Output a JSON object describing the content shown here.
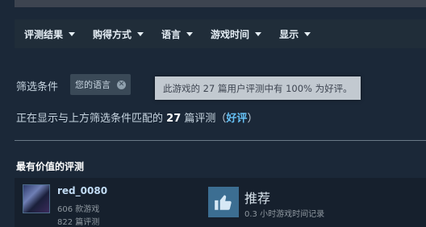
{
  "filter_bar": {
    "items": [
      {
        "label": "评测结果"
      },
      {
        "label": "购得方式"
      },
      {
        "label": "语言"
      },
      {
        "label": "游戏时间"
      },
      {
        "label": "显示"
      }
    ]
  },
  "filters": {
    "label": "筛选条件",
    "chip": "您的语言",
    "tooltip": "此游戏的 27 篇用户评测中有 100% 为好评。"
  },
  "summary": {
    "prefix": "正在显示与上方筛选条件匹配的",
    "count": "27",
    "suffix": "篇评测",
    "open_paren": "（",
    "rating": "好评",
    "close_paren": "）"
  },
  "section": {
    "title": "最有价值的评测"
  },
  "review": {
    "user_name": "red_0080",
    "games_owned": "606 款游戏",
    "reviews_written": "822 篇评测",
    "recommend": "推荐",
    "playtime": "0.3 小时游戏时间记录"
  },
  "colors": {
    "background": "#1b2838",
    "filter_bar": "#202d39",
    "accent": "#66c0f4",
    "thumb_box": "#3c6e92"
  }
}
